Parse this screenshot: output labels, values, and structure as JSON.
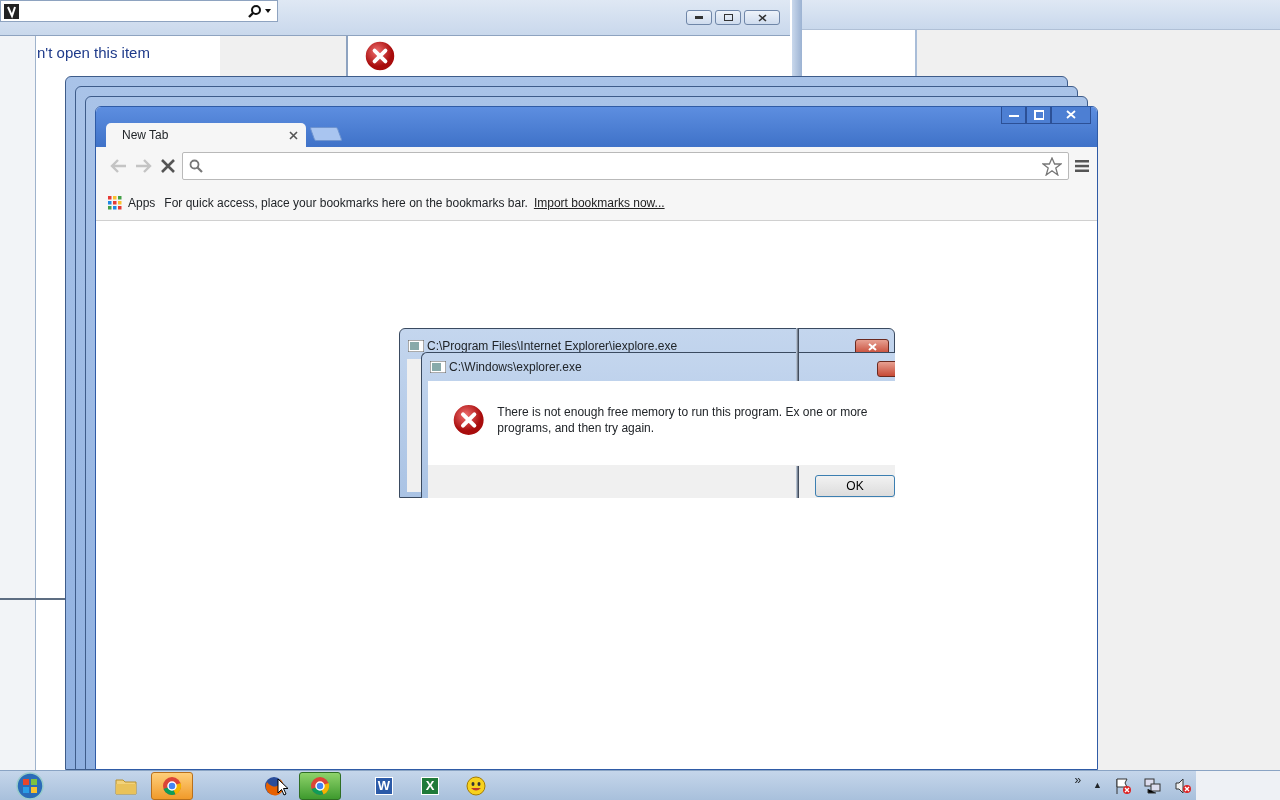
{
  "explorer_window": {
    "message": "n't open this item"
  },
  "browser": {
    "tabs": [
      {
        "label": "New Tab",
        "selected": true
      }
    ],
    "bookmarks_bar": {
      "apps_label": "Apps",
      "message": "For quick access, place your bookmarks here on the bookmarks bar.",
      "import_link": "Import bookmarks now..."
    }
  },
  "dialogs": [
    {
      "title": "C:\\Program Files\\Internet Explorer\\iexplore.exe"
    },
    {
      "title": "C:\\Windows\\explorer.exe",
      "message": "There is not enough free memory to run this program. Ex one or more programs, and then try again.",
      "button": "OK"
    }
  ],
  "taskbar": {
    "items": [
      {
        "kind": "folder",
        "selected": false,
        "flashing": false
      },
      {
        "kind": "chrome",
        "selected": false,
        "flashing": true
      },
      {
        "kind": "firefox",
        "selected": false,
        "flashing": false
      },
      {
        "kind": "chrome",
        "selected": true,
        "flashing": false
      },
      {
        "kind": "word",
        "label": "W",
        "selected": false,
        "flashing": false
      },
      {
        "kind": "excel",
        "label": "X",
        "selected": false,
        "flashing": false
      },
      {
        "kind": "messenger",
        "selected": false,
        "flashing": false
      }
    ],
    "tray": {
      "overflow": "»",
      "show_hidden": "▲"
    }
  }
}
